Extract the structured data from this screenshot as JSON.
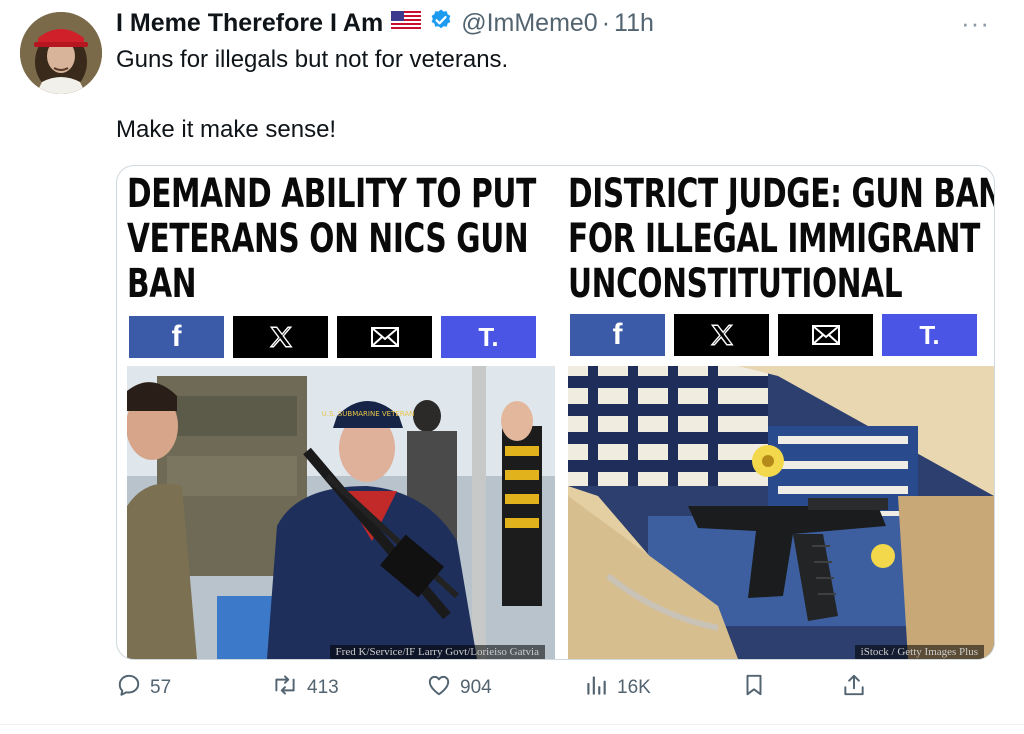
{
  "tweet": {
    "display_name": "I Meme Therefore I Am",
    "flag": "🇺🇸",
    "handle": "@ImMeme0",
    "separator": "·",
    "time": "11h",
    "more": "···",
    "text_line1": "Guns for illegals but not for veterans.",
    "text_line2": "Make it make sense!"
  },
  "media": {
    "left": {
      "headline": "DEMAND ABILITY TO PUT VETERANS ON NICS GUN BAN",
      "hat_text": "U.S. SUBMARINE VETERAN",
      "caption": "Fred K/Service/IF Larry Govt/Lorieiso Gatvia"
    },
    "right": {
      "headline": "DISTRICT JUDGE: GUN BAN FOR ILLEGAL IMMIGRANT UNCONSTITUTIONAL",
      "caption": "iStock / Getty Images Plus"
    },
    "share": {
      "facebook": "f",
      "truth": "T."
    }
  },
  "actions": {
    "replies": "57",
    "reposts": "413",
    "likes": "904",
    "views": "16K"
  },
  "colors": {
    "facebook": "#3b5aa8",
    "truth": "#4a55e6",
    "verified": "#1d9bf0",
    "muted": "#536471"
  }
}
